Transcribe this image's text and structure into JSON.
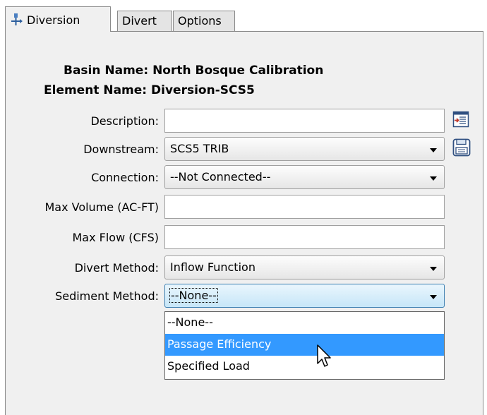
{
  "tabs": [
    {
      "label": "Diversion",
      "active": true,
      "icon": "diversion-icon"
    },
    {
      "label": "Divert",
      "active": false
    },
    {
      "label": "Options",
      "active": false
    }
  ],
  "header": {
    "basin_label": "Basin Name:",
    "basin_value": "North Bosque Calibration",
    "element_label": "Element Name:",
    "element_value": "Diversion-SCS5"
  },
  "fields": {
    "description": {
      "label": "Description:",
      "value": ""
    },
    "downstream": {
      "label": "Downstream:",
      "value": "SCS5 TRIB"
    },
    "connection": {
      "label": "Connection:",
      "value": "--Not Connected--"
    },
    "max_volume": {
      "label": "Max Volume (AC-FT)",
      "value": ""
    },
    "max_flow": {
      "label": "Max Flow (CFS)",
      "value": ""
    },
    "divert_method": {
      "label": "Divert Method:",
      "value": "Inflow Function"
    },
    "sediment_method": {
      "label": "Sediment Method:",
      "value": "--None--"
    }
  },
  "dropdown": {
    "options": [
      "--None--",
      "Passage Efficiency",
      "Specified Load"
    ],
    "highlighted_index": 1
  },
  "icons": {
    "description_editor": "edit-description-icon",
    "downstream_select": "select-downstream-icon"
  },
  "colors": {
    "highlight": "#3399ff",
    "focus_border": "#3c7fb1",
    "panel_bg": "#f0f0f0"
  }
}
